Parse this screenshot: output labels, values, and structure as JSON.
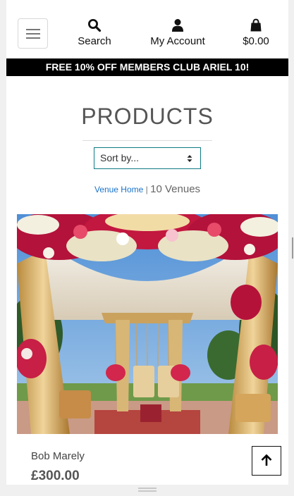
{
  "header": {
    "menu_icon": "hamburger-icon",
    "search": {
      "label": "Search",
      "icon": "search-icon"
    },
    "account": {
      "label": "My Account",
      "icon": "user-icon"
    },
    "bag": {
      "total": "$0.00",
      "icon": "shopping-bag-icon"
    }
  },
  "promo_banner": "FREE 10% OFF MEMBERS CLUB ARIEL 10!",
  "main": {
    "title": "PRODUCTS",
    "sort": {
      "selected": "Sort by..."
    },
    "breadcrumb": {
      "link": "Venue Home",
      "separator": "|",
      "count": "10 Venues"
    }
  },
  "products": [
    {
      "name": "Bob Marely",
      "price": "£300.00",
      "image": "wedding-mandap-photo"
    }
  ],
  "controls": {
    "back_to_top_icon": "arrow-up-icon"
  },
  "colors": {
    "accent_teal": "#0e7c86",
    "link_blue": "#1a73c9",
    "banner_bg": "#000000"
  }
}
